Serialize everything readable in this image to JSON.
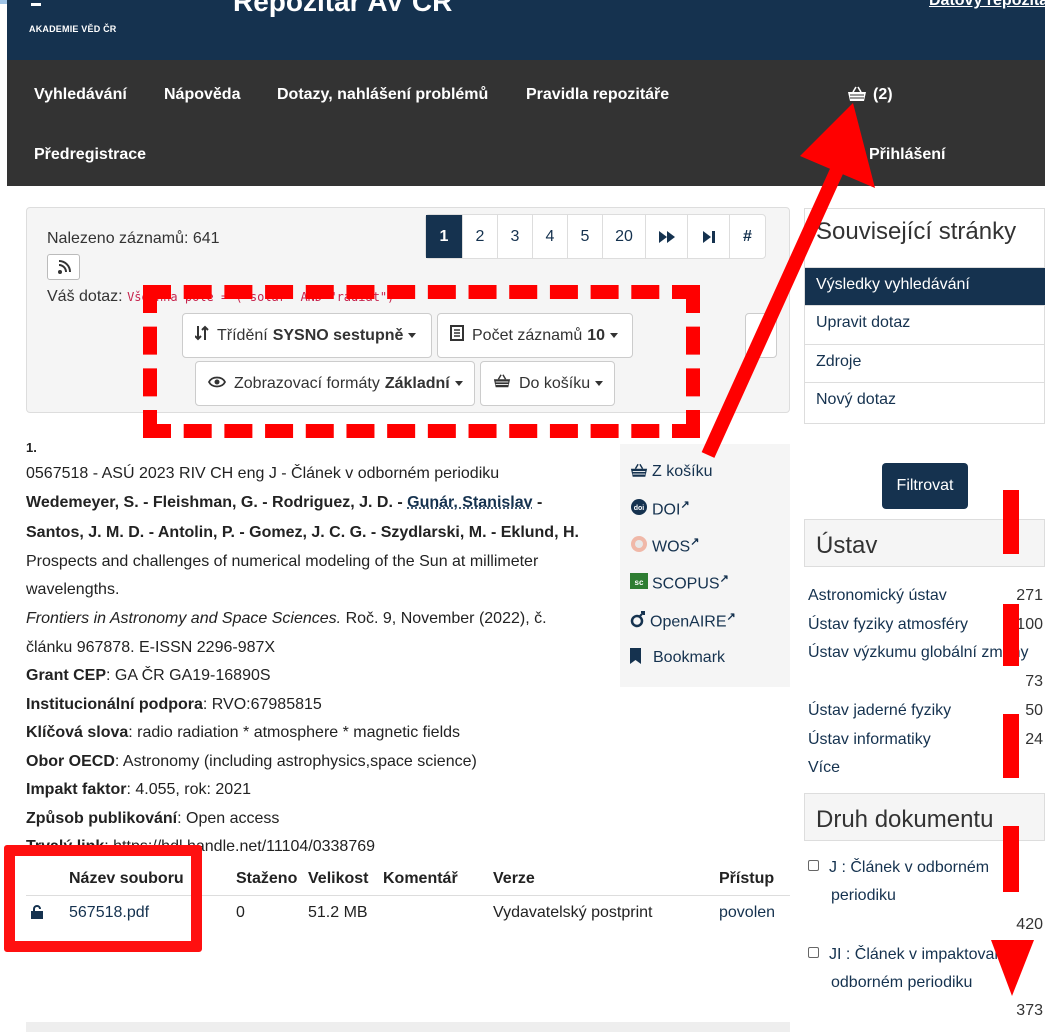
{
  "header": {
    "academy": "AKADEMIE VĚD ČR",
    "title": "Repozitář AV ČR",
    "right_link": "Datový repozitář"
  },
  "nav": {
    "items": [
      "Vyhledávání",
      "Nápověda",
      "Dotazy, nahlášení problémů",
      "Pravidla repozitáře"
    ],
    "cart_label": "(2)",
    "preregistration": "Předregistrace",
    "login": "Přihlášení"
  },
  "toolbar": {
    "found_label": "Nalezeno záznamů: 641",
    "query_label": "Váš dotaz:",
    "query_code": "Všechna pole = (\"solar\" AND \"radiat\")",
    "pages": [
      "1",
      "2",
      "3",
      "4",
      "5",
      "20",
      "⏩",
      "⏭",
      "#"
    ],
    "active_page": "1",
    "sort_label": "Třídění",
    "sort_value": "SYSNO sestupně",
    "count_label": "Počet záznamů",
    "count_value": "10",
    "format_label": "Zobrazovací formáty",
    "format_value": "Základní",
    "cart_label": "Do košíku"
  },
  "record": {
    "number": "1.",
    "id_line": "0567518 - ASÚ 2023 RIV CH eng J - Článek v odborném periodiku",
    "authors_a": "Wedemeyer, S. - Fleishman, G. - Rodriguez, J. D. -",
    "authors_link": "Gunár, Stanislav",
    "authors_a_end": "-",
    "authors_b": "Santos, J. M. D. - Antolin, P. - Gomez, J. C. G. - Szydlarski, M. - Eklund, H.",
    "title_1": "Prospects and challenges of numerical modeling of the Sun at millimeter",
    "title_2": "wavelengths.",
    "journal": "Frontiers in Astronomy and Space Sciences.",
    "journal_rest": "Roč. 9, November (2022), č.",
    "article_no": "článku 967878. E-ISSN 2296-987X",
    "grant_label": "Grant CEP",
    "grant_value": ": GA ČR GA19-16890S",
    "inst_label": "Institucionální podpora",
    "inst_value": ": RVO:67985815",
    "keywords_label": "Klíčová slova",
    "keywords_value": ": radio radiation * atmosphere * magnetic fields",
    "oecd_label": "Obor OECD",
    "oecd_value": ": Astronomy (including astrophysics,space science)",
    "impact_label": "Impakt faktor",
    "impact_value": ": 4.055, rok: 2021",
    "pub_label": "Způsob publikování",
    "pub_value": ": Open access",
    "link_label": "Trvalý link",
    "link_value": ": https://hdl.handle.net/11104/0338769"
  },
  "actions": {
    "remove_cart": "Z košíku",
    "doi": "DOI",
    "wos": "WOS",
    "scopus": "SCOPUS",
    "openaire": "OpenAIRE",
    "bookmark": "Bookmark"
  },
  "files": {
    "headers": [
      "Název souboru",
      "Staženo",
      "Velikost",
      "Komentář",
      "Verze",
      "Přístup"
    ],
    "row": {
      "name": "567518.pdf",
      "downloads": "0",
      "size": "51.2 MB",
      "comment": "",
      "version": "Vydavatelský postprint",
      "access": "povolen"
    }
  },
  "sidebar": {
    "related_heading": "Související stránky",
    "related_items": [
      "Výsledky vyhledávání",
      "Upravit dotaz",
      "Zdroje",
      "Nový dotaz"
    ],
    "filter_button": "Filtrovat",
    "ustav_heading": "Ústav",
    "ustav_items": [
      {
        "label": "Astronomický ústav",
        "count": "271"
      },
      {
        "label": "Ústav fyziky atmosféry",
        "count": "100"
      },
      {
        "label": "Ústav výzkumu globální změny",
        "count": "73"
      },
      {
        "label": "Ústav jaderné fyziky",
        "count": "50"
      },
      {
        "label": "Ústav informatiky",
        "count": "24"
      }
    ],
    "more": "Více",
    "doc_heading": "Druh dokumentu",
    "doc_items": [
      {
        "label_1": "J : Článek v odborném",
        "label_2": "periodiku",
        "count": "420"
      },
      {
        "label_1": "JI : Článek v impaktovaném",
        "label_2": "odborném periodiku",
        "count": "373"
      }
    ]
  },
  "colors": {
    "brand": "#15324f",
    "nav": "#333333",
    "annotation": "#ff0000"
  }
}
